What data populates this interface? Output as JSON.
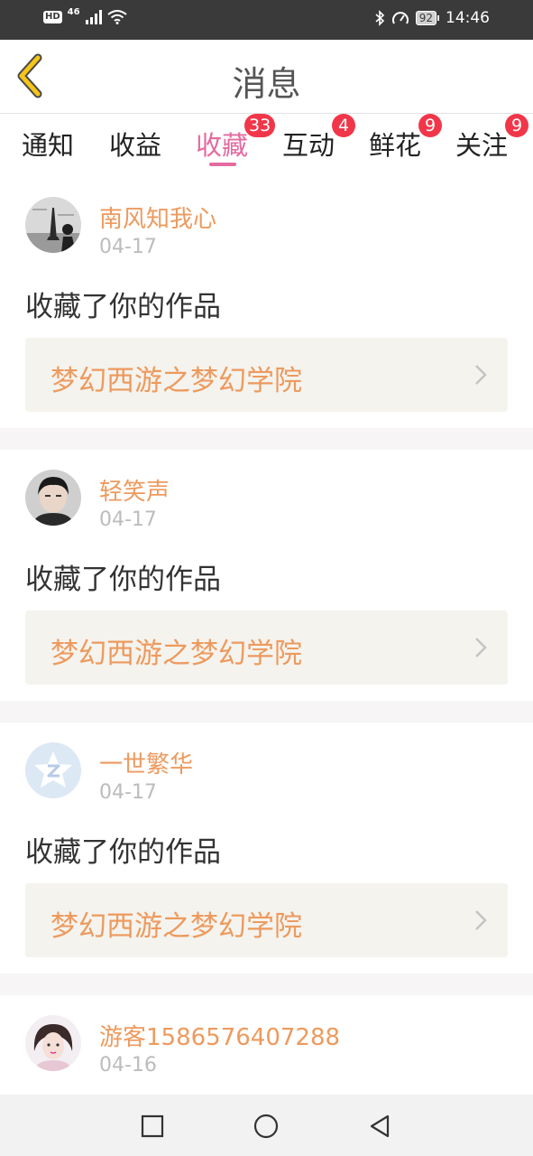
{
  "status_bar": {
    "hd": "HD",
    "network": "46",
    "battery": "92",
    "time": "14:46",
    "icons": [
      "signal-icon",
      "wifi-icon",
      "bluetooth-icon",
      "speed-icon"
    ]
  },
  "header": {
    "title": "消息",
    "back_icon": "chevron-left-icon"
  },
  "tabs": [
    {
      "label": "通知",
      "badge": ""
    },
    {
      "label": "收益",
      "badge": ""
    },
    {
      "label": "收藏",
      "badge": "33",
      "active": true
    },
    {
      "label": "互动",
      "badge": "4"
    },
    {
      "label": "鲜花",
      "badge": "9"
    },
    {
      "label": "关注",
      "badge": "9"
    }
  ],
  "messages": [
    {
      "user": "南风知我心",
      "date": "04-17",
      "action": "收藏了你的作品",
      "work": "梦幻西游之梦幻学院"
    },
    {
      "user": "轻笑声",
      "date": "04-17",
      "action": "收藏了你的作品",
      "work": "梦幻西游之梦幻学院"
    },
    {
      "user": "一世繁华",
      "date": "04-17",
      "action": "收藏了你的作品",
      "work": "梦幻西游之梦幻学院"
    },
    {
      "user": "游客1586576407288",
      "date": "04-16"
    }
  ],
  "colors": {
    "accent": "#e36b9f",
    "orange": "#ed9a5e",
    "badge": "#f2364a",
    "back": "#f5c518"
  },
  "navbar": {
    "icons": [
      "recent-apps-icon",
      "home-icon",
      "back-triangle-icon"
    ]
  }
}
